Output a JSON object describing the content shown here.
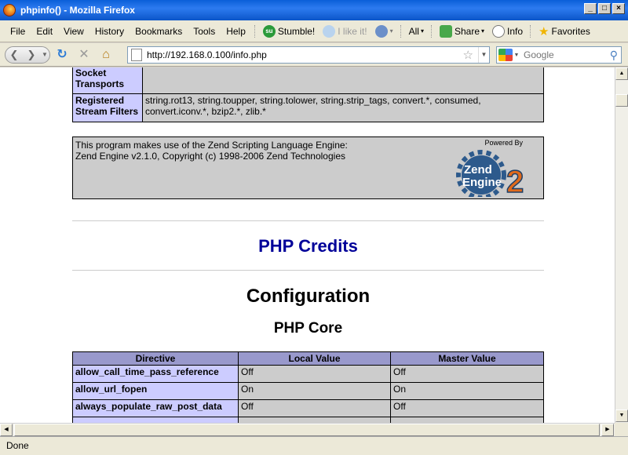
{
  "window": {
    "title": "phpinfo() - Mozilla Firefox"
  },
  "menu": {
    "items": [
      "File",
      "Edit",
      "View",
      "History",
      "Bookmarks",
      "Tools",
      "Help"
    ],
    "stumble_label": "Stumble!",
    "like_label": "I like it!",
    "all_label": "All",
    "share_label": "Share",
    "info_label": "Info",
    "favorites_label": "Favorites"
  },
  "nav": {
    "url": "http://192.168.0.100/info.php",
    "search_placeholder": "Google"
  },
  "page": {
    "top_rows": [
      {
        "key": "Socket Transports",
        "value": ""
      },
      {
        "key": "Registered Stream Filters",
        "value": "string.rot13, string.toupper, string.tolower, string.strip_tags, convert.*, consumed, convert.iconv.*, bzip2.*, zlib.*"
      }
    ],
    "zend_text_line1": "This program makes use of the Zend Scripting Language Engine:",
    "zend_text_line2": "Zend Engine v2.1.0, Copyright (c) 1998-2006 Zend Technologies",
    "powered_by": "Powered By",
    "credits_link": "PHP Credits",
    "config_heading": "Configuration",
    "core_heading": "PHP Core",
    "core_table": {
      "headers": [
        "Directive",
        "Local Value",
        "Master Value"
      ],
      "rows": [
        {
          "directive": "allow_call_time_pass_reference",
          "local": "Off",
          "master": "Off"
        },
        {
          "directive": "allow_url_fopen",
          "local": "On",
          "master": "On"
        },
        {
          "directive": "always_populate_raw_post_data",
          "local": "Off",
          "master": "Off"
        }
      ]
    }
  },
  "status": {
    "text": "Done"
  },
  "colors": {
    "header_row": "#9999cc",
    "key_cell": "#ccccff",
    "value_cell": "#cccccc",
    "credits_link": "#000099"
  }
}
